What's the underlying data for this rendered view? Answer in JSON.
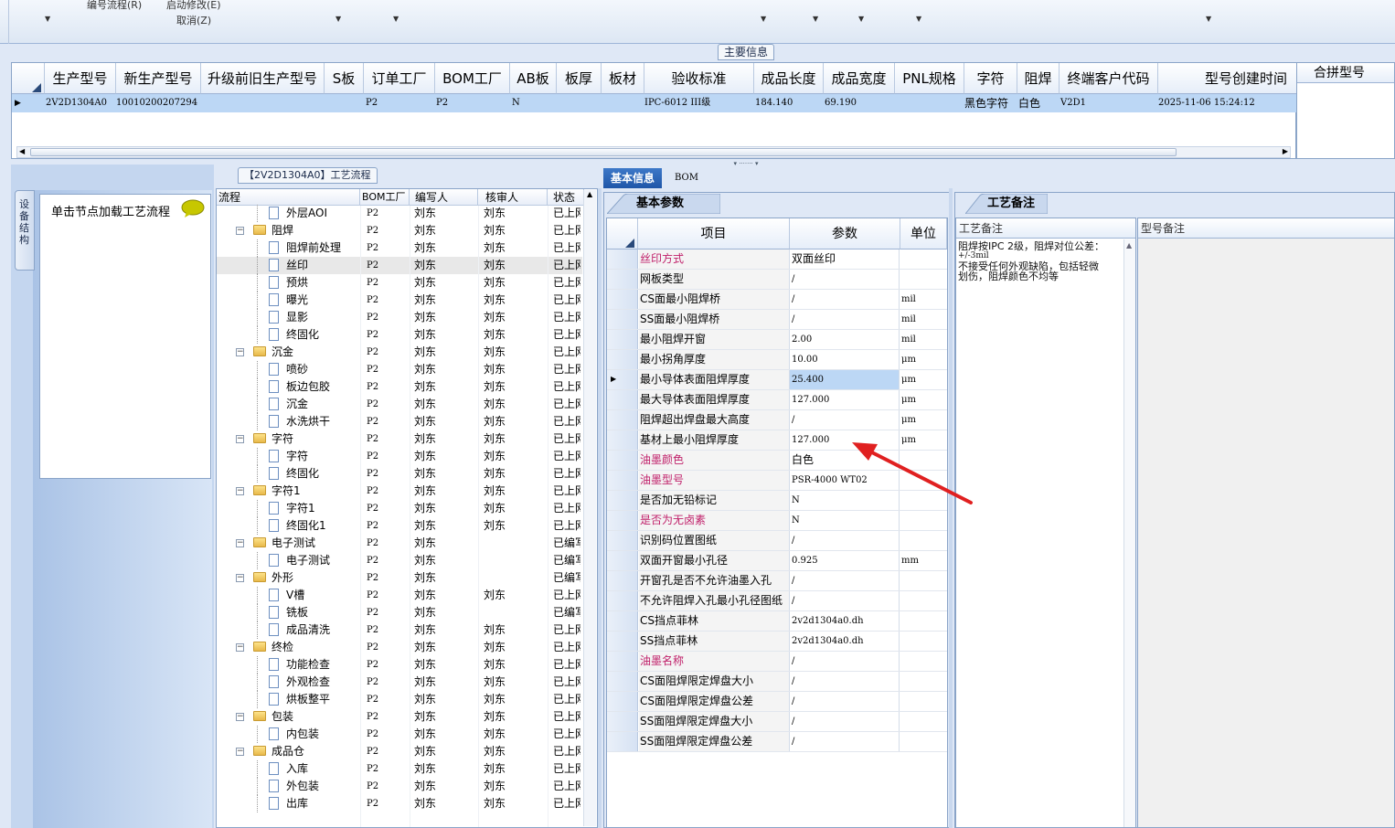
{
  "toolbar": {
    "item1": "编号流程(R)",
    "item2": "启动修改(E)",
    "item3": "取消(Z)"
  },
  "main_section_label": "主要信息",
  "main_grid": {
    "columns": [
      "生产型号",
      "新生产型号",
      "升级前旧生产型号",
      "S板",
      "订单工厂",
      "BOM工厂",
      "AB板",
      "板厚",
      "板材",
      "验收标准",
      "成品长度",
      "成品宽度",
      "PNL规格",
      "字符",
      "阻焊",
      "终端客户代码",
      "型号创建时间"
    ],
    "row": {
      "prod_model": "2V2D1304A0",
      "new_model": "10010200207294",
      "order_factory": "P2",
      "bom_factory": "P2",
      "ab_board": "N",
      "standard": "IPC-6012 III级",
      "length": "184.140",
      "width": "69.190",
      "char": "黑色字符",
      "mask": "白色",
      "customer": "V2D1",
      "created": "2025-11-06 15:24:12"
    }
  },
  "merge_header": "合拼型号",
  "left_panel": {
    "vertical_tab": "设备结构",
    "hint": "单击节点加载工艺流程"
  },
  "process_section_label": "【2V2D1304A0】工艺流程",
  "tree": {
    "headers": [
      "流程",
      "BOM工厂",
      "编写人",
      "核审人",
      "状态"
    ],
    "rows": [
      {
        "name": "外层AOI",
        "level": 2,
        "folder": false,
        "bom": "P2",
        "writer": "刘东",
        "reviewer": "刘东",
        "status": "已上网"
      },
      {
        "name": "阻焊",
        "level": 1,
        "folder": true,
        "bom": "P2",
        "writer": "刘东",
        "reviewer": "刘东",
        "status": "已上网"
      },
      {
        "name": "阻焊前处理",
        "level": 2,
        "folder": false,
        "bom": "P2",
        "writer": "刘东",
        "reviewer": "刘东",
        "status": "已上网"
      },
      {
        "name": "丝印",
        "level": 2,
        "folder": false,
        "bom": "P2",
        "writer": "刘东",
        "reviewer": "刘东",
        "status": "已上网"
      },
      {
        "name": "预烘",
        "level": 2,
        "folder": false,
        "bom": "P2",
        "writer": "刘东",
        "reviewer": "刘东",
        "status": "已上网"
      },
      {
        "name": "曝光",
        "level": 2,
        "folder": false,
        "bom": "P2",
        "writer": "刘东",
        "reviewer": "刘东",
        "status": "已上网"
      },
      {
        "name": "显影",
        "level": 2,
        "folder": false,
        "bom": "P2",
        "writer": "刘东",
        "reviewer": "刘东",
        "status": "已上网"
      },
      {
        "name": "终固化",
        "level": 2,
        "folder": false,
        "bom": "P2",
        "writer": "刘东",
        "reviewer": "刘东",
        "status": "已上网"
      },
      {
        "name": "沉金",
        "level": 1,
        "folder": true,
        "bom": "P2",
        "writer": "刘东",
        "reviewer": "刘东",
        "status": "已上网"
      },
      {
        "name": "喷砂",
        "level": 2,
        "folder": false,
        "bom": "P2",
        "writer": "刘东",
        "reviewer": "刘东",
        "status": "已上网"
      },
      {
        "name": "板边包胶",
        "level": 2,
        "folder": false,
        "bom": "P2",
        "writer": "刘东",
        "reviewer": "刘东",
        "status": "已上网"
      },
      {
        "name": "沉金",
        "level": 2,
        "folder": false,
        "bom": "P2",
        "writer": "刘东",
        "reviewer": "刘东",
        "status": "已上网"
      },
      {
        "name": "水洗烘干",
        "level": 2,
        "folder": false,
        "bom": "P2",
        "writer": "刘东",
        "reviewer": "刘东",
        "status": "已上网"
      },
      {
        "name": "字符",
        "level": 1,
        "folder": true,
        "bom": "P2",
        "writer": "刘东",
        "reviewer": "刘东",
        "status": "已上网"
      },
      {
        "name": "字符",
        "level": 2,
        "folder": false,
        "bom": "P2",
        "writer": "刘东",
        "reviewer": "刘东",
        "status": "已上网"
      },
      {
        "name": "终固化",
        "level": 2,
        "folder": false,
        "bom": "P2",
        "writer": "刘东",
        "reviewer": "刘东",
        "status": "已上网"
      },
      {
        "name": "字符1",
        "level": 1,
        "folder": true,
        "bom": "P2",
        "writer": "刘东",
        "reviewer": "刘东",
        "status": "已上网"
      },
      {
        "name": "字符1",
        "level": 2,
        "folder": false,
        "bom": "P2",
        "writer": "刘东",
        "reviewer": "刘东",
        "status": "已上网"
      },
      {
        "name": "终固化1",
        "level": 2,
        "folder": false,
        "bom": "P2",
        "writer": "刘东",
        "reviewer": "刘东",
        "status": "已上网"
      },
      {
        "name": "电子测试",
        "level": 1,
        "folder": true,
        "bom": "P2",
        "writer": "刘东",
        "reviewer": "",
        "status": "已编写"
      },
      {
        "name": "电子测试",
        "level": 2,
        "folder": false,
        "bom": "P2",
        "writer": "刘东",
        "reviewer": "",
        "status": "已编写"
      },
      {
        "name": "外形",
        "level": 1,
        "folder": true,
        "bom": "P2",
        "writer": "刘东",
        "reviewer": "",
        "status": "已编写"
      },
      {
        "name": "V槽",
        "level": 2,
        "folder": false,
        "bom": "P2",
        "writer": "刘东",
        "reviewer": "刘东",
        "status": "已上网"
      },
      {
        "name": "铣板",
        "level": 2,
        "folder": false,
        "bom": "P2",
        "writer": "刘东",
        "reviewer": "",
        "status": "已编写"
      },
      {
        "name": "成品清洗",
        "level": 2,
        "folder": false,
        "bom": "P2",
        "writer": "刘东",
        "reviewer": "刘东",
        "status": "已上网"
      },
      {
        "name": "终检",
        "level": 1,
        "folder": true,
        "bom": "P2",
        "writer": "刘东",
        "reviewer": "刘东",
        "status": "已上网"
      },
      {
        "name": "功能检查",
        "level": 2,
        "folder": false,
        "bom": "P2",
        "writer": "刘东",
        "reviewer": "刘东",
        "status": "已上网"
      },
      {
        "name": "外观检查",
        "level": 2,
        "folder": false,
        "bom": "P2",
        "writer": "刘东",
        "reviewer": "刘东",
        "status": "已上网"
      },
      {
        "name": "烘板整平",
        "level": 2,
        "folder": false,
        "bom": "P2",
        "writer": "刘东",
        "reviewer": "刘东",
        "status": "已上网"
      },
      {
        "name": "包装",
        "level": 1,
        "folder": true,
        "bom": "P2",
        "writer": "刘东",
        "reviewer": "刘东",
        "status": "已上网"
      },
      {
        "name": "内包装",
        "level": 2,
        "folder": false,
        "bom": "P2",
        "writer": "刘东",
        "reviewer": "刘东",
        "status": "已上网"
      },
      {
        "name": "成品仓",
        "level": 1,
        "folder": true,
        "bom": "P2",
        "writer": "刘东",
        "reviewer": "刘东",
        "status": "已上网"
      },
      {
        "name": "入库",
        "level": 2,
        "folder": false,
        "bom": "P2",
        "writer": "刘东",
        "reviewer": "刘东",
        "status": "已上网"
      },
      {
        "name": "外包装",
        "level": 2,
        "folder": false,
        "bom": "P2",
        "writer": "刘东",
        "reviewer": "刘东",
        "status": "已上网"
      },
      {
        "name": "出库",
        "level": 2,
        "folder": false,
        "bom": "P2",
        "writer": "刘东",
        "reviewer": "刘东",
        "status": "已上网"
      }
    ]
  },
  "center_tabs": [
    "基本信息",
    "BOM"
  ],
  "param_tab": "基本参数",
  "param_grid": {
    "headers": [
      "项目",
      "参数",
      "单位"
    ],
    "rows": [
      {
        "item": "丝印方式",
        "value": "双面丝印",
        "unit": "",
        "required": true
      },
      {
        "item": "网板类型",
        "value": "/",
        "unit": "",
        "required": false
      },
      {
        "item": "CS面最小阻焊桥",
        "value": "/",
        "unit": "mil",
        "required": false
      },
      {
        "item": "SS面最小阻焊桥",
        "value": "/",
        "unit": "mil",
        "required": false
      },
      {
        "item": "最小阻焊开窗",
        "value": "2.00",
        "unit": "mil",
        "required": false
      },
      {
        "item": "最小拐角厚度",
        "value": "10.00",
        "unit": "μm",
        "required": false
      },
      {
        "item": "最小导体表面阻焊厚度",
        "value": "25.400",
        "unit": "μm",
        "required": false,
        "current": true
      },
      {
        "item": "最大导体表面阻焊厚度",
        "value": "127.000",
        "unit": "μm",
        "required": false
      },
      {
        "item": "阻焊超出焊盘最大高度",
        "value": "/",
        "unit": "μm",
        "required": false
      },
      {
        "item": "基材上最小阻焊厚度",
        "value": "127.000",
        "unit": "μm",
        "required": false
      },
      {
        "item": "油墨颜色",
        "value": "白色",
        "unit": "",
        "required": true
      },
      {
        "item": "油墨型号",
        "value": "PSR-4000 WT02",
        "unit": "",
        "required": true
      },
      {
        "item": "是否加无铅标记",
        "value": "N",
        "unit": "",
        "required": false
      },
      {
        "item": "是否为无卤素",
        "value": "N",
        "unit": "",
        "required": true
      },
      {
        "item": "识别码位置图纸",
        "value": "/",
        "unit": "",
        "required": false
      },
      {
        "item": "双面开窗最小孔径",
        "value": "0.925",
        "unit": "mm",
        "required": false
      },
      {
        "item": "开窗孔是否不允许油墨入孔",
        "value": "/",
        "unit": "",
        "required": false
      },
      {
        "item": "不允许阻焊入孔最小孔径图纸",
        "value": "/",
        "unit": "",
        "required": false
      },
      {
        "item": "CS挡点菲林",
        "value": "2v2d1304a0.dh",
        "unit": "",
        "required": false
      },
      {
        "item": "SS挡点菲林",
        "value": "2v2d1304a0.dh",
        "unit": "",
        "required": false
      },
      {
        "item": "油墨名称",
        "value": "/",
        "unit": "",
        "required": true
      },
      {
        "item": "CS面阻焊限定焊盘大小",
        "value": "/",
        "unit": "",
        "required": false
      },
      {
        "item": "CS面阻焊限定焊盘公差",
        "value": "/",
        "unit": "",
        "required": false
      },
      {
        "item": "SS面阻焊限定焊盘大小",
        "value": "/",
        "unit": "",
        "required": false
      },
      {
        "item": "SS面阻焊限定焊盘公差",
        "value": "/",
        "unit": "",
        "required": false
      }
    ]
  },
  "notes": {
    "tab": "工艺备注",
    "col1": "工艺备注",
    "col2": "型号备注",
    "text_lines": [
      "阻焊按IPC 2级，阻焊对位公差：",
      "+/-3mil",
      "不接受任何外观缺陷，包括轻微",
      "划伤，阻焊颜色不均等"
    ]
  },
  "colors": {
    "required": "#c0206a",
    "selected_row": "#bcd7f5",
    "arrow": "#e02020"
  }
}
